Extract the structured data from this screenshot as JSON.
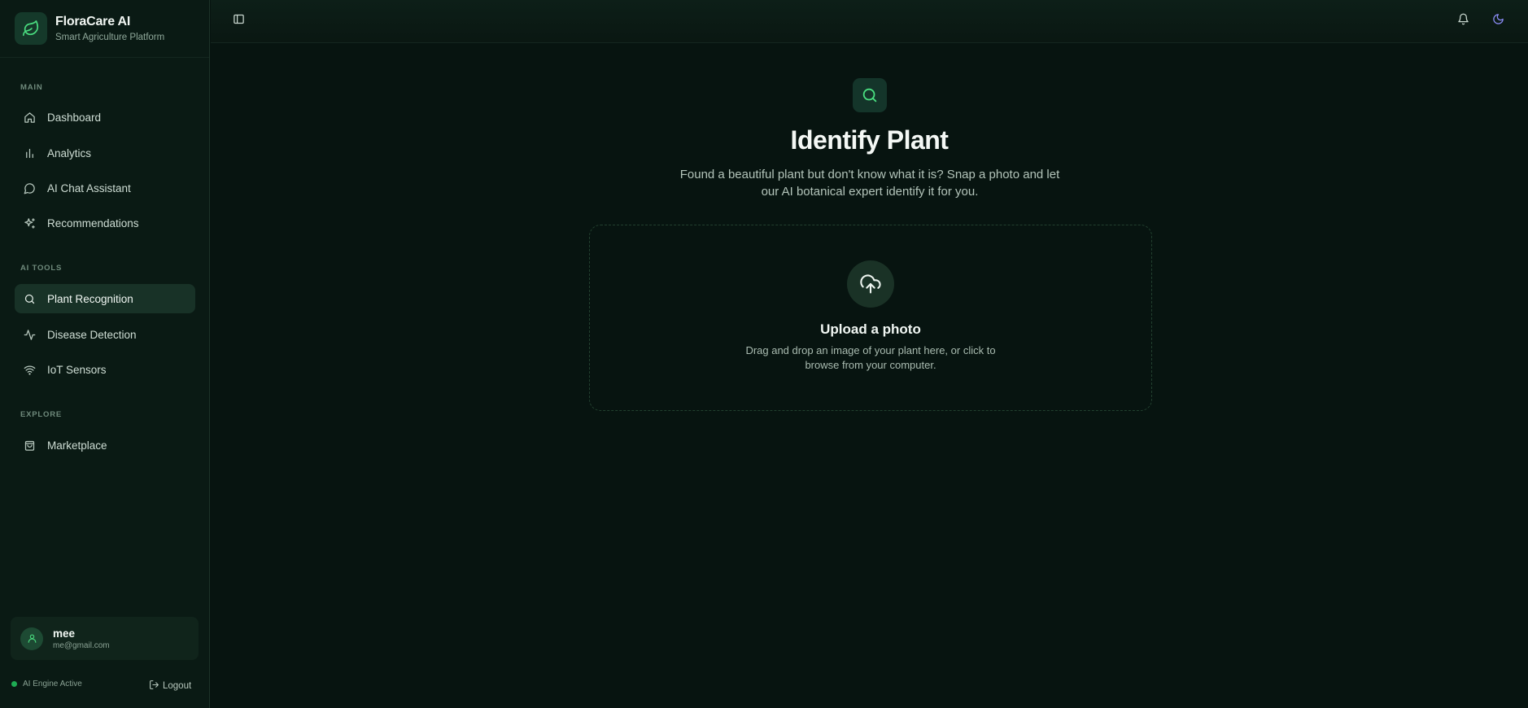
{
  "brand": {
    "name": "FloraCare AI",
    "subtitle": "Smart Agriculture Platform",
    "logo_icon": "leaf-icon"
  },
  "sidebar": {
    "sections": [
      {
        "label": "MAIN",
        "items": [
          {
            "label": "Dashboard",
            "icon": "home-icon",
            "active": false
          },
          {
            "label": "Analytics",
            "icon": "bar-chart-icon",
            "active": false
          },
          {
            "label": "AI Chat Assistant",
            "icon": "chat-bubble-icon",
            "active": false
          },
          {
            "label": "Recommendations",
            "icon": "sparkles-icon",
            "active": false
          }
        ]
      },
      {
        "label": "AI TOOLS",
        "items": [
          {
            "label": "Plant Recognition",
            "icon": "search-icon",
            "active": true
          },
          {
            "label": "Disease Detection",
            "icon": "activity-icon",
            "active": false
          },
          {
            "label": "IoT Sensors",
            "icon": "wifi-icon",
            "active": false
          }
        ]
      },
      {
        "label": "EXPLORE",
        "items": [
          {
            "label": "Marketplace",
            "icon": "shopping-bag-icon",
            "active": false
          }
        ]
      }
    ]
  },
  "user": {
    "name": "mee",
    "email": "me@gmail.com"
  },
  "status": {
    "engine_label": "AI Engine Active",
    "engine_color": "#22c55e"
  },
  "logout_label": "Logout",
  "topbar": {
    "toggle_icon": "sidebar-toggle-icon",
    "bell_icon": "bell-icon",
    "theme_icon": "moon-icon"
  },
  "page": {
    "title": "Identify Plant",
    "description": "Found a beautiful plant but don't know what it is? Snap a photo and let our AI botanical expert identify it for you.",
    "icon": "search-icon"
  },
  "upload": {
    "title": "Upload a photo",
    "description": "Drag and drop an image of your plant here, or click to browse from your computer.",
    "icon": "cloud-upload-icon"
  },
  "colors": {
    "accent": "#22c55e",
    "background": "#071410",
    "sidebar": "#0a1a14",
    "theme_icon": "#8b8cf6"
  }
}
